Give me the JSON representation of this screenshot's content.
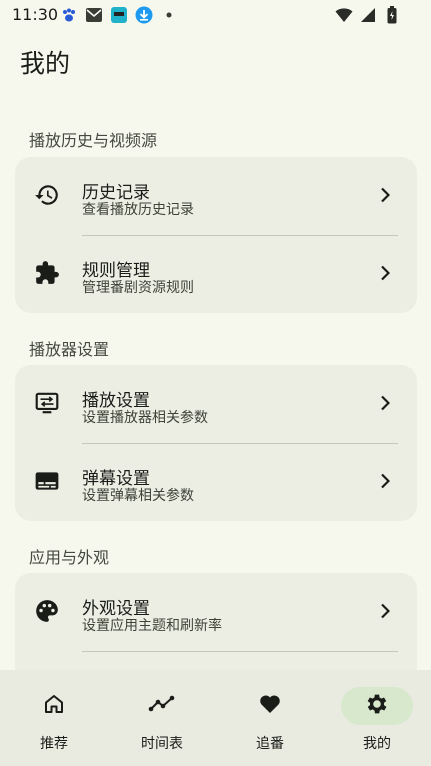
{
  "status": {
    "time": "11:30"
  },
  "page": {
    "title": "我的"
  },
  "sections": [
    {
      "label": "播放历史与视频源",
      "items": [
        {
          "title": "历史记录",
          "subtitle": "查看播放历史记录",
          "icon": "history-icon"
        },
        {
          "title": "规则管理",
          "subtitle": "管理番剧资源规则",
          "icon": "puzzle-icon"
        }
      ]
    },
    {
      "label": "播放器设置",
      "items": [
        {
          "title": "播放设置",
          "subtitle": "设置播放器相关参数",
          "icon": "player-settings-icon"
        },
        {
          "title": "弹幕设置",
          "subtitle": "设置弹幕相关参数",
          "icon": "danmaku-icon"
        }
      ]
    },
    {
      "label": "应用与外观",
      "items": [
        {
          "title": "外观设置",
          "subtitle": "设置应用主题和刷新率",
          "icon": "palette-icon"
        }
      ]
    }
  ],
  "nav": [
    {
      "label": "推荐",
      "icon": "home-icon",
      "active": false
    },
    {
      "label": "时间表",
      "icon": "timeline-icon",
      "active": false
    },
    {
      "label": "追番",
      "icon": "heart-icon",
      "active": false
    },
    {
      "label": "我的",
      "icon": "gear-icon",
      "active": true
    }
  ],
  "colors": {
    "background": "#f6f8ee",
    "card": "#eceee4",
    "nav_active": "#d7e8cd"
  }
}
